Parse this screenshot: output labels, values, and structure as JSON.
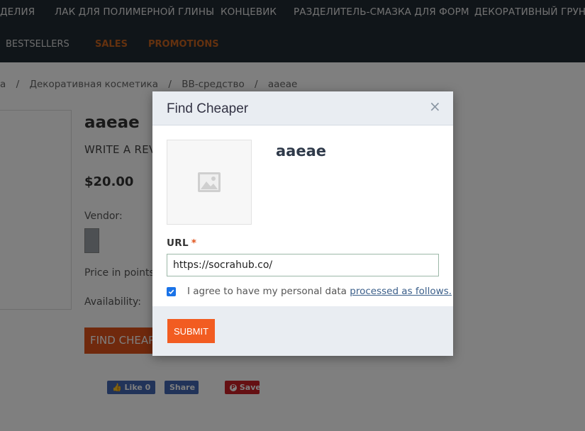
{
  "nav": {
    "top_items": [
      "делия",
      "Лак для полимерной глины",
      "Концевик",
      "Разделитель-смазка для форм",
      "Декоративный грунт а"
    ],
    "bottom_items": [
      {
        "label": "Bestsellers",
        "color": "#d8d8d8"
      },
      {
        "label": "Sales",
        "color": "#e06a22"
      },
      {
        "label": "Promotions",
        "color": "#e06a22"
      }
    ]
  },
  "breadcrumb": [
    "а",
    "/",
    "Декоративная косметика",
    "/",
    "ВВ-средство",
    "/",
    "aaeae"
  ],
  "product": {
    "title": "aaeae",
    "write_review": "WRITE A REV",
    "price": "$20.00",
    "vendor_label": "Vendor:",
    "points_label": "Price in points:",
    "availability_label": "Availability:",
    "find_cheaper_label": "FIND CHEAPER"
  },
  "social": {
    "like_label": "Like 0",
    "share_label": "Share",
    "save_label": "Save"
  },
  "modal": {
    "title": "Find Cheaper",
    "close_symbol": "×",
    "product_name": "aaeae",
    "url_label": "URL",
    "required_mark": "*",
    "url_value": "https://socrahub.co/",
    "agree_text": "I agree to have my personal data",
    "agree_link": "processed as follows.",
    "agree_checked": true,
    "submit_label": "Submit"
  },
  "colors": {
    "accent": "#f25c21",
    "nav_bg": "#212a33",
    "facebook": "#4267b2",
    "pinterest": "#cb2027"
  }
}
